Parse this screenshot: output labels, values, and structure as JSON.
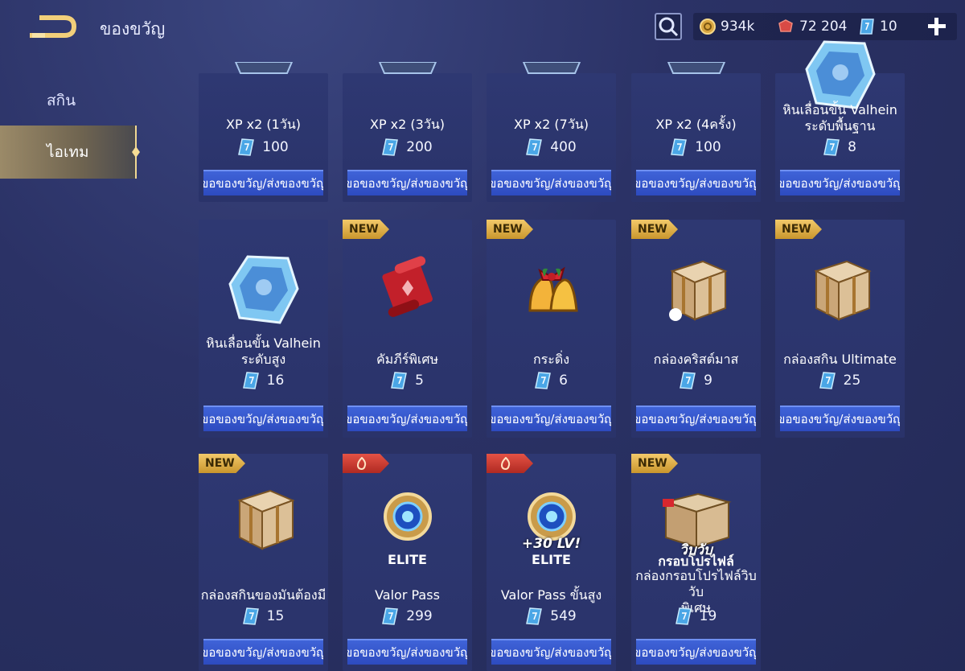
{
  "header": {
    "title": "ของขวัญ",
    "coins": "934k",
    "vouchers": "72 204",
    "tickets": "10"
  },
  "sidebar": {
    "items": [
      {
        "label": "สกิน",
        "active": false
      },
      {
        "label": "ไอเทม",
        "active": true
      }
    ]
  },
  "gift_button_label": "ขอของขวัญ/ส่งของขวัญ",
  "new_badge": "NEW",
  "items": [
    {
      "name": "XP x2 (1วัน)",
      "name2": "",
      "price": "100",
      "badge": "",
      "art": "xp-card"
    },
    {
      "name": "XP x2 (3วัน)",
      "name2": "",
      "price": "200",
      "badge": "",
      "art": "xp-card"
    },
    {
      "name": "XP x2 (7วัน)",
      "name2": "",
      "price": "400",
      "badge": "",
      "art": "xp-card"
    },
    {
      "name": "XP x2 (4ครั้ง)",
      "name2": "",
      "price": "100",
      "badge": "",
      "art": "xp-card"
    },
    {
      "name": "หินเลื่อนขั้น Valhein",
      "name2": "ระดับพื้นฐาน",
      "price": "8",
      "badge": "",
      "art": "crystal"
    },
    {
      "name": "หินเลื่อนขั้น Valhein",
      "name2": "ระดับสูง",
      "price": "16",
      "badge": "",
      "art": "crystal"
    },
    {
      "name": "คัมภีร์พิเศษ",
      "name2": "",
      "price": "5",
      "badge": "new",
      "art": "scroll"
    },
    {
      "name": "กระดิ่ง",
      "name2": "",
      "price": "6",
      "badge": "new",
      "art": "bell"
    },
    {
      "name": "กล่องคริสต์มาส",
      "name2": "",
      "price": "9",
      "badge": "new",
      "art": "box"
    },
    {
      "name": "กล่องสกิน Ultimate",
      "name2": "",
      "price": "25",
      "badge": "new",
      "art": "box"
    },
    {
      "name": "กล่องสกินของมันต้องมี",
      "name2": "",
      "price": "15",
      "badge": "new",
      "art": "box"
    },
    {
      "name": "Valor Pass",
      "name2": "",
      "price": "299",
      "badge": "hot",
      "art": "medal",
      "art_text": "ELITE"
    },
    {
      "name": "Valor Pass ขั้นสูง",
      "name2": "",
      "price": "549",
      "badge": "hot",
      "art": "medal",
      "art_text": "ELITE",
      "art_text2": "+30 LV!"
    },
    {
      "name": "กล่องกรอบโปรไฟล์วิบวับ",
      "name2": "พิเศษ",
      "price": "19",
      "badge": "new",
      "art": "frame-box",
      "art_text": "กรอบโปรไฟล์",
      "art_text2": "วิบวับ"
    }
  ],
  "colors": {
    "button_blue": "#3f63d8",
    "badge_gold": "#e9b84a",
    "badge_red": "#d5402f"
  }
}
